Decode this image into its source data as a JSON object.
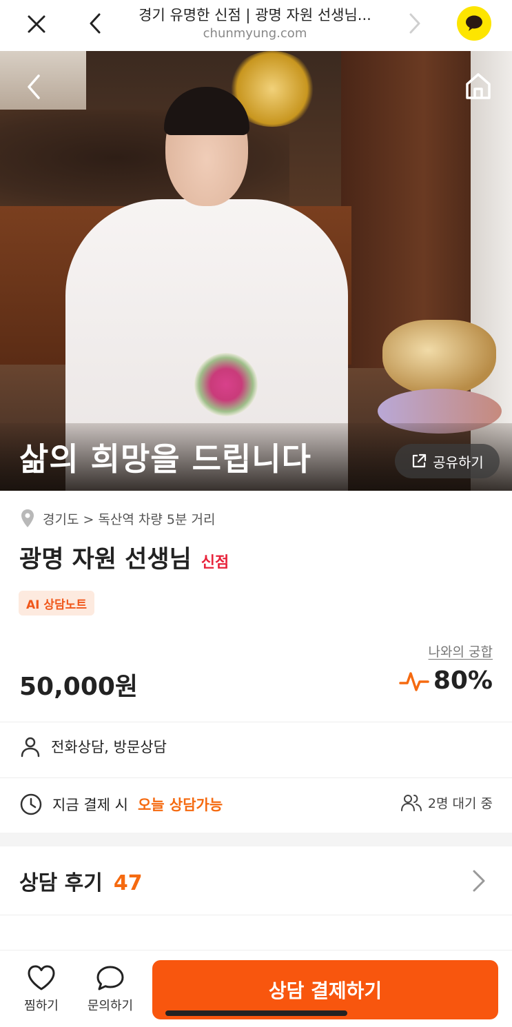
{
  "browser": {
    "title": "경기 유명한 신점 | 광명 자원 선생님...",
    "domain": "chunmyung.com",
    "icons": {
      "close": "close-icon",
      "back": "chevron-left-icon",
      "forward": "chevron-right-icon",
      "chat": "kakao-chat-icon"
    }
  },
  "hero": {
    "slogan": "삶의 희망을 드립니다",
    "share_label": "공유하기",
    "icons": {
      "back": "chevron-left-icon",
      "home": "home-icon",
      "share": "external-link-icon"
    }
  },
  "profile": {
    "location": "경기도 > 독산역 차량 5분 거리",
    "name": "광명 자원 선생님",
    "category_badge": "신점",
    "ai_tag": "AI 상담노트",
    "compat_label": "나와의 궁합",
    "price": "50,000원",
    "compat_value": "80%"
  },
  "details": {
    "consult_types": "전화상담, 방문상담",
    "pay_prefix": "지금 결제 시",
    "pay_highlight": "오늘 상담가능",
    "waiting": "2명 대기 중"
  },
  "reviews": {
    "label": "상담 후기",
    "count": "47"
  },
  "bottom": {
    "like_label": "찜하기",
    "ask_label": "문의하기",
    "pay_label": "상담 결제하기"
  },
  "colors": {
    "accent": "#f8560e",
    "badge_red": "#e8233b",
    "kakao": "#fde500"
  }
}
